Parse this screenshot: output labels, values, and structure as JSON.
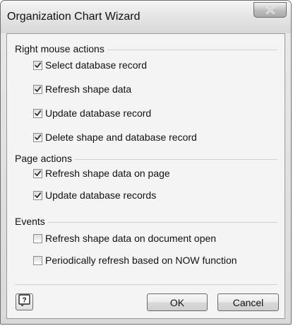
{
  "window": {
    "title": "Organization Chart Wizard",
    "close_icon": "close-icon"
  },
  "sections": [
    {
      "label": "Right mouse actions",
      "items": [
        {
          "label": "Select database record",
          "checked": true
        },
        {
          "label": "Refresh shape data",
          "checked": true
        },
        {
          "label": "Update database record",
          "checked": true
        },
        {
          "label": "Delete shape and database record",
          "checked": true
        }
      ]
    },
    {
      "label": "Page actions",
      "items": [
        {
          "label": "Refresh shape data on page",
          "checked": true
        },
        {
          "label": "Update database records",
          "checked": true
        }
      ]
    },
    {
      "label": "Events",
      "items": [
        {
          "label": "Refresh shape data on document open",
          "checked": false
        },
        {
          "label": "Periodically refresh based on NOW function",
          "checked": false
        }
      ]
    }
  ],
  "buttons": {
    "help_icon": "help-icon",
    "ok_label": "OK",
    "cancel_label": "Cancel"
  }
}
